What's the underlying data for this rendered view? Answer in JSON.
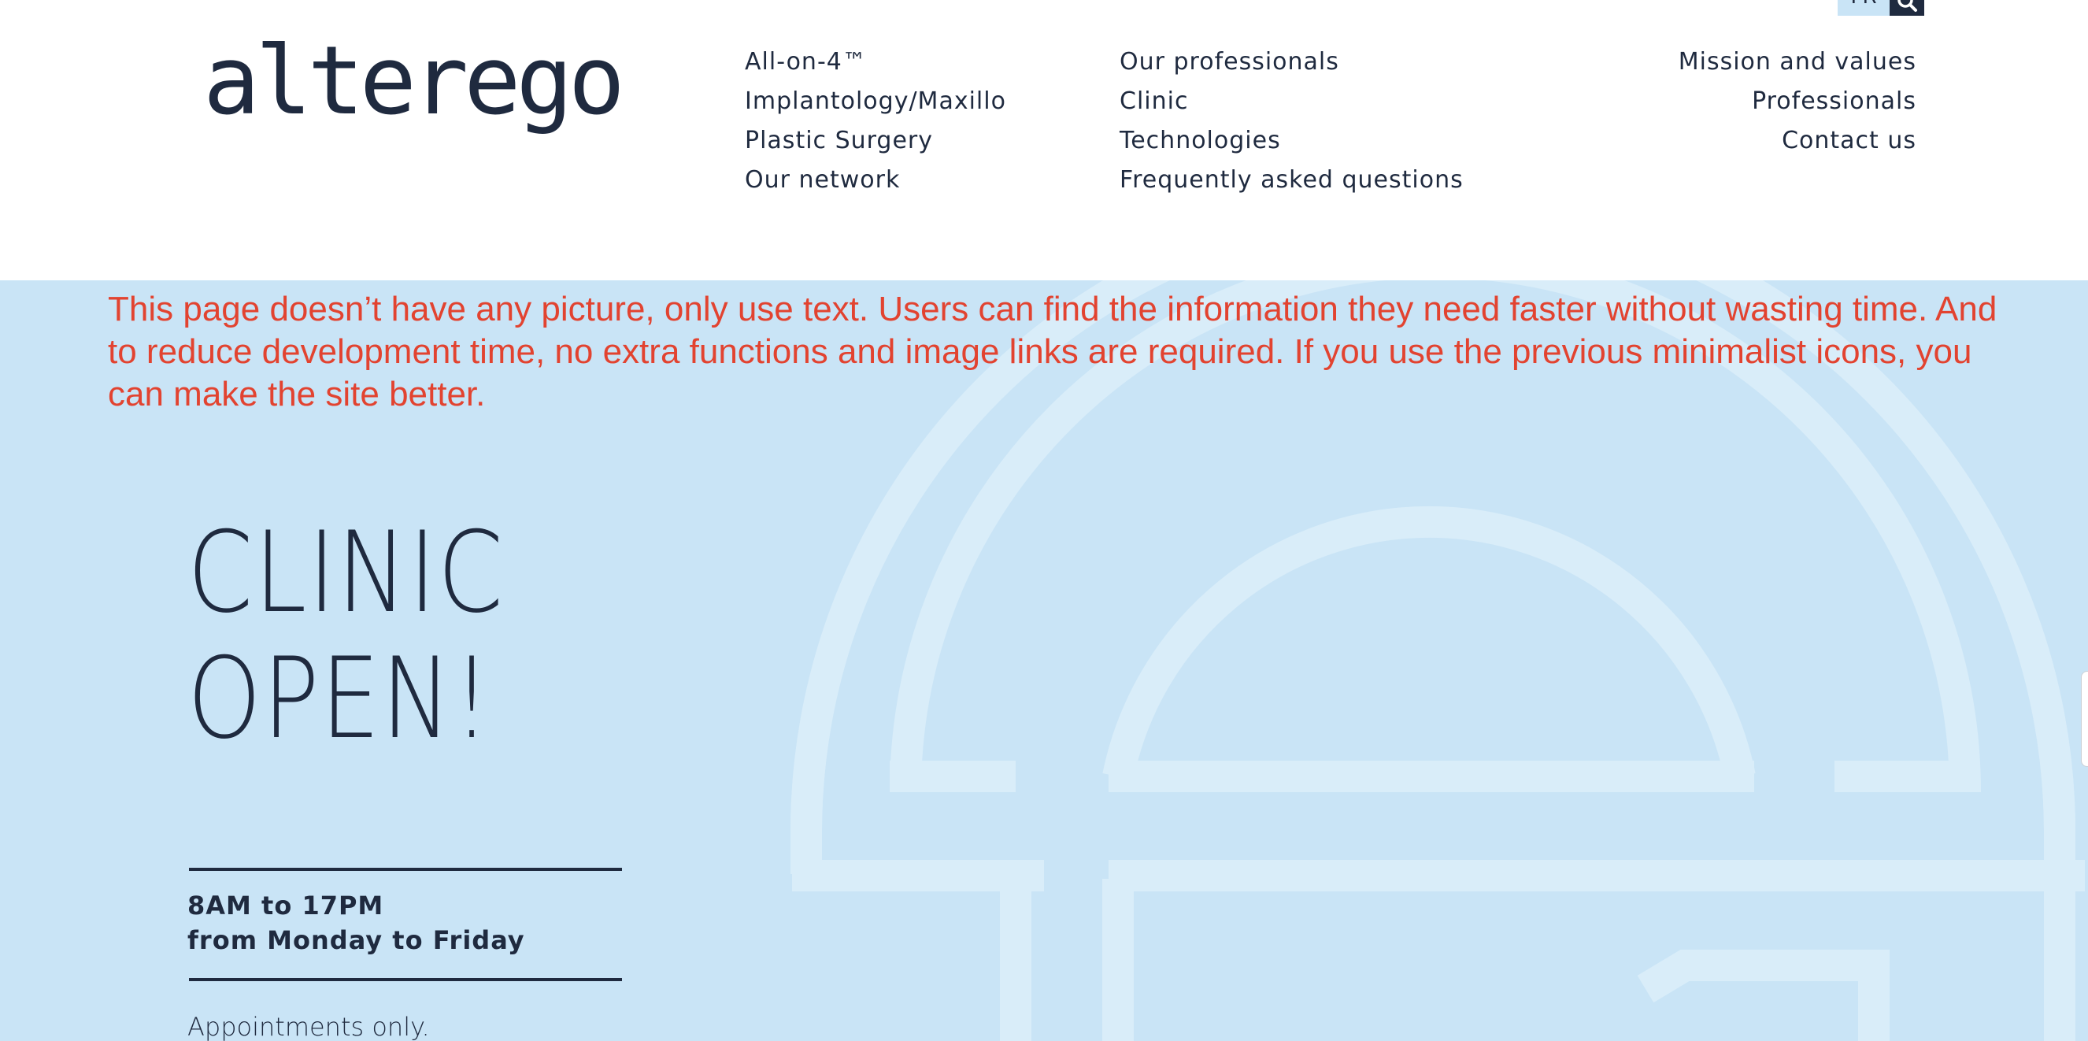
{
  "header": {
    "lang_label": "FR",
    "logo_text": "alterego",
    "nav_col1": [
      "All-on-4™",
      "Implantology/Maxillo",
      "Plastic Surgery",
      "Our network"
    ],
    "nav_col2": [
      "Our professionals",
      "Clinic",
      "Technologies",
      "Frequently asked questions"
    ],
    "nav_col3": [
      "Mission and values",
      "Professionals",
      "Contact us"
    ]
  },
  "hero": {
    "annotation": "This page doesn’t have any picture, only use text. Users can find the information they need faster without wasting time. And to reduce development time, no extra functions and image links are required. If you use the previous minimalist icons, you can make the site better.",
    "title_line1": "CLINIC",
    "title_line2": "OPEN!",
    "hours_line1": "8AM to 17PM",
    "hours_line2": "from Monday to Friday",
    "appointments": "Appointments only."
  },
  "icons": {
    "search": "search-icon",
    "background": "brand-mark-watermark"
  },
  "colors": {
    "navy": "#1f2a3f",
    "hero_bg": "#c9e4f6",
    "annotation_red": "#e24330",
    "watermark": "#d9edf9"
  }
}
